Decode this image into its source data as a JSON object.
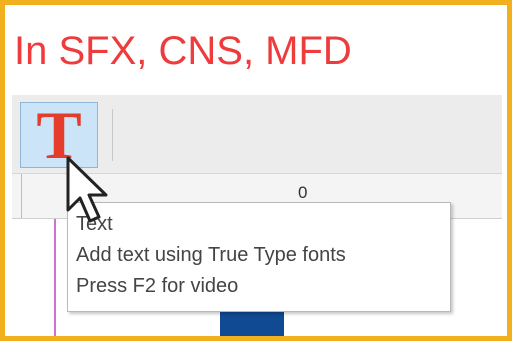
{
  "heading": "In SFX, CNS, MFD",
  "toolbar": {
    "text_tool": {
      "glyph": "T",
      "icon": "text-tool-icon",
      "selected": true
    }
  },
  "ruler": {
    "label": "0"
  },
  "tooltip": {
    "title": "Text",
    "description": "Add text using True Type fonts",
    "hint": "Press F2 for video"
  },
  "colors": {
    "frame_border": "#f2b01e",
    "heading": "#ee3b3b",
    "tool_glyph": "#e53c2c",
    "tool_selected_bg": "#cce4f7",
    "guide_line": "#d070d0",
    "canvas_object": "#0f4a93"
  }
}
